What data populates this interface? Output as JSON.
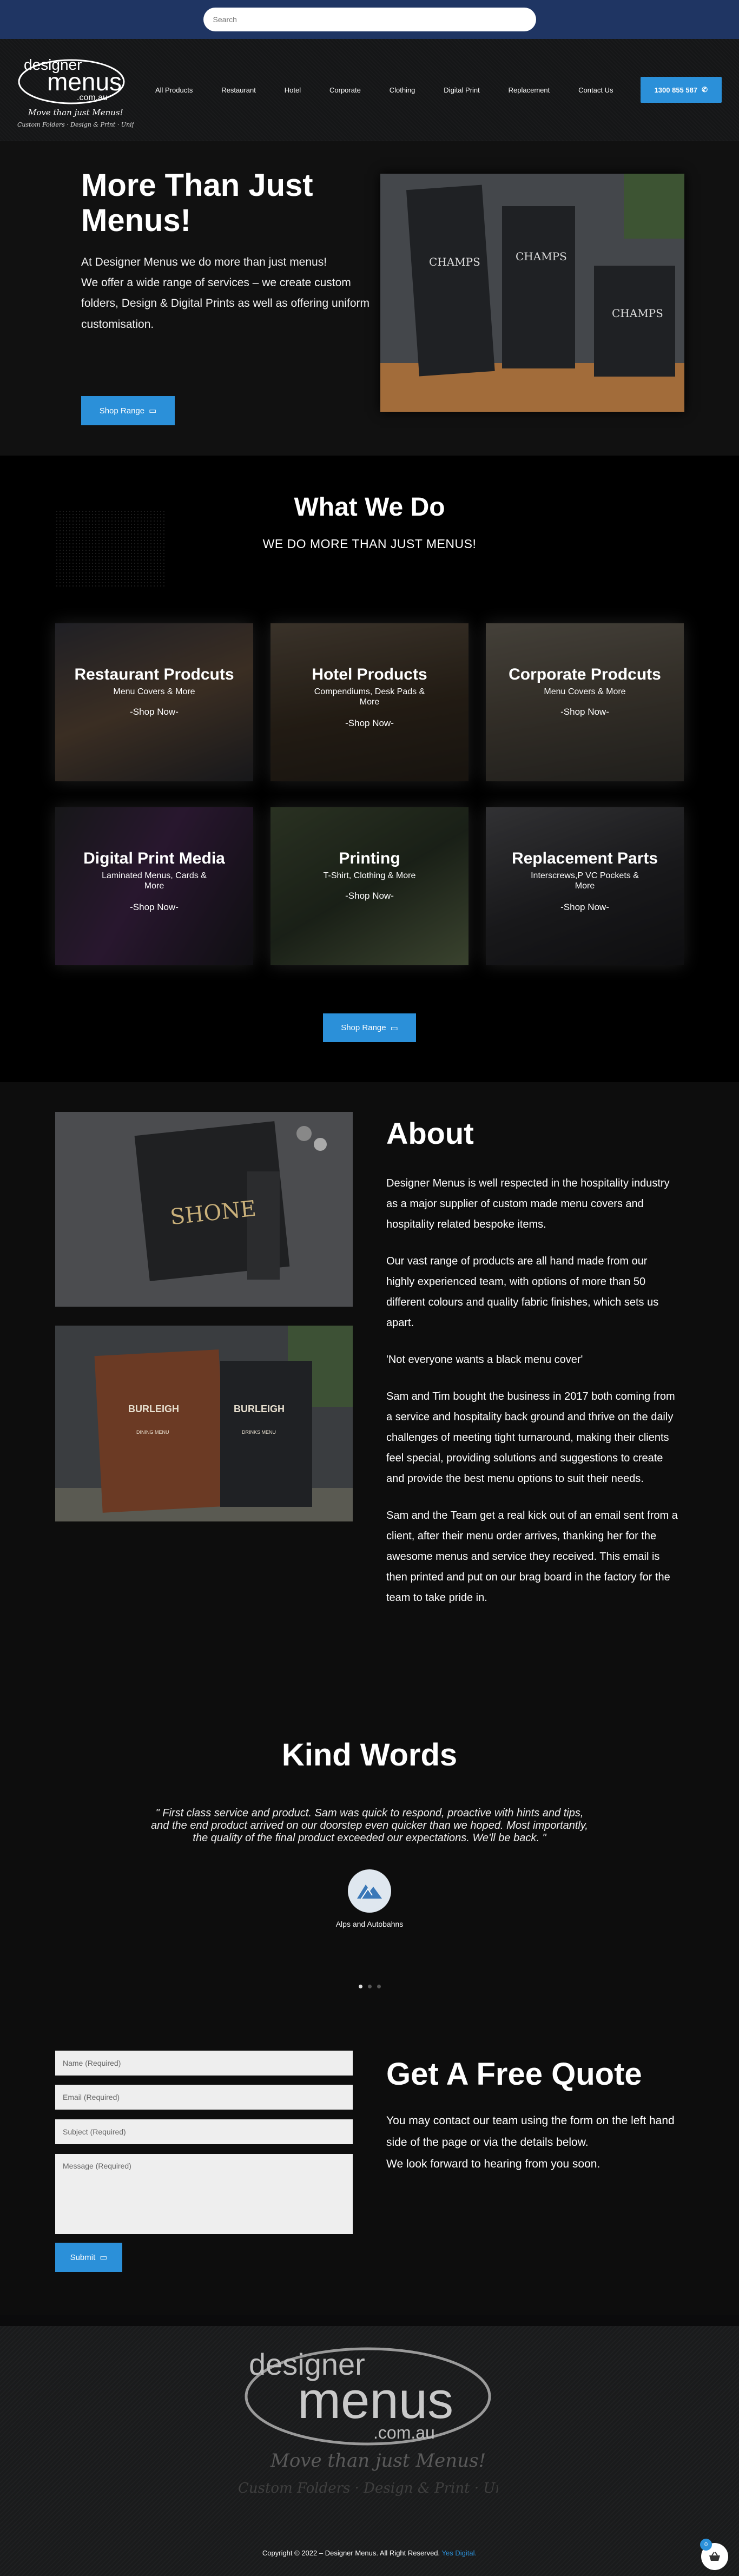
{
  "search": {
    "placeholder": "Search"
  },
  "header": {
    "logo": {
      "line1": "designer",
      "line2": "menus",
      "domain": ".com.au",
      "tagline": "Move than just Menus!",
      "subtag": "Custom Folders · Design & Print · Uniforms"
    },
    "nav": [
      "All Products",
      "Restaurant",
      "Hotel",
      "Corporate",
      "Clothing",
      "Digital Print",
      "Replacement",
      "Contact Us"
    ],
    "phone": "1300 855 587"
  },
  "hero": {
    "title": "More Than Just Menus!",
    "lines": [
      "At Designer Menus we do more than just menus!",
      "We offer a wide range of services – we create custom",
      "folders, Design & Digital Prints as well as offering uniform customisation."
    ],
    "button": "Shop Range",
    "image_text": [
      "CHAMPS",
      "CHAMPS",
      "CHAMPS"
    ]
  },
  "what_we_do": {
    "title": "What We Do",
    "subtitle": "WE DO MORE THAN JUST MENUS!",
    "cards": [
      {
        "title": "Restaurant Prodcuts",
        "sub": "Menu Covers & More",
        "shop": "-Shop Now-"
      },
      {
        "title": "Hotel Products",
        "sub": "Compendiums, Desk Pads & More",
        "shop": "-Shop Now-"
      },
      {
        "title": "Corporate Prodcuts",
        "sub": "Menu Covers & More",
        "shop": "-Shop Now-"
      },
      {
        "title": "Digital Print Media",
        "sub": "Laminated Menus, Cards & More",
        "shop": "-Shop Now-"
      },
      {
        "title": "Printing",
        "sub": "T-Shirt, Clothing & More",
        "shop": "-Shop Now-"
      },
      {
        "title": "Replacement Parts",
        "sub": "Interscrews,P VC Pockets & More",
        "shop": "-Shop Now-"
      }
    ],
    "button": "Shop Range"
  },
  "about": {
    "title": "About",
    "paragraphs": [
      "Designer Menus is well respected in the hospitality industry as a major supplier of custom made menu covers and hospitality related bespoke items.",
      "Our vast range of products are all hand made from our highly experienced team, with options of more than 50 different colours and quality fabric finishes, which sets us apart.",
      "'Not everyone wants a black menu cover'",
      "Sam and Tim bought the business in 2017 both coming from a service and hospitality back ground and thrive on the daily challenges of meeting tight turnaround, making their clients feel special, providing solutions and suggestions to create and provide the best menu options to suit their needs.",
      "Sam and the Team get a real kick out of an email sent from a client, after their menu order arrives, thanking her for the awesome menus and service they received. This email is then printed and put on our brag board in the factory for the team to take pride in."
    ],
    "img1_text": "SHONE",
    "img2_text": {
      "left": "BURLEIGH",
      "left_sub": "DINING MENU",
      "right": "BURLEIGH",
      "right_sub": "DRINKS MENU"
    }
  },
  "kind_words": {
    "title": "Kind Words",
    "quote": "\" First class service and product. Sam was quick to respond, proactive with hints and tips, and the end product arrived on our doorstep even quicker than we hoped. Most importantly, the quality of the final product exceeded our expectations. We'll be back. \"",
    "name": "Alps and Autobahns",
    "active_dot": 0
  },
  "quote_form": {
    "fields": [
      "Name (Required)",
      "Email (Required)",
      "Subject (Required)"
    ],
    "message": "Message (Required)",
    "submit": "Submit",
    "title": "Get A Free Quote",
    "lines": [
      "You may contact our team using the form on the left hand side of the page or via the details below.",
      "We look forward to hearing from you soon."
    ]
  },
  "footer": {
    "logo": {
      "line1": "designer",
      "line2": "menus",
      "domain": ".com.au",
      "tagline": "Move than just Menus!",
      "subtag": "Custom Folders · Design & Print · Uniforms"
    },
    "copyright": "Copyright © 2022 – Designer Menus. All Right Reserved.",
    "credit": "Yes Digital.",
    "cart_count": "0"
  },
  "colors": {
    "accent": "#2b90d9",
    "topbar": "#1f3563",
    "bg": "#0b0b0c"
  }
}
